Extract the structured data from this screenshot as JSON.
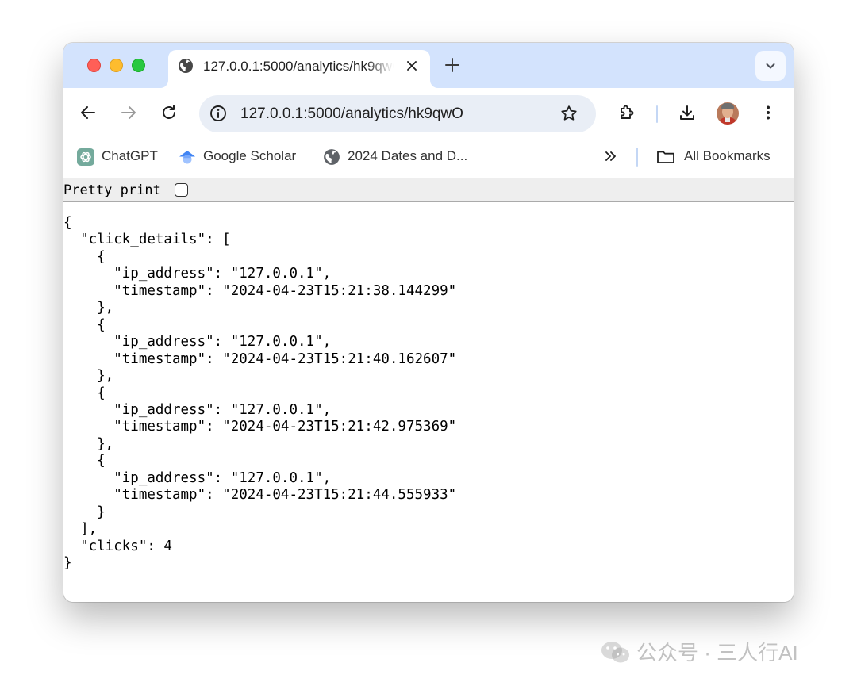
{
  "tab": {
    "title": "127.0.0.1:5000/analytics/hk9qwO",
    "icon": "globe-icon"
  },
  "toolbar": {
    "url": "127.0.0.1:5000/analytics/hk9qwO"
  },
  "bookmarks": {
    "items": [
      {
        "label": "ChatGPT",
        "icon": "chatgpt-icon"
      },
      {
        "label": "Google Scholar",
        "icon": "scholar-icon"
      },
      {
        "label": "2024 Dates and D...",
        "icon": "globe-icon"
      }
    ],
    "all_label": "All Bookmarks"
  },
  "pretty_print": {
    "label": "Pretty print",
    "checked": false
  },
  "json_text": "{\n  \"click_details\": [\n    {\n      \"ip_address\": \"127.0.0.1\",\n      \"timestamp\": \"2024-04-23T15:21:38.144299\"\n    },\n    {\n      \"ip_address\": \"127.0.0.1\",\n      \"timestamp\": \"2024-04-23T15:21:40.162607\"\n    },\n    {\n      \"ip_address\": \"127.0.0.1\",\n      \"timestamp\": \"2024-04-23T15:21:42.975369\"\n    },\n    {\n      \"ip_address\": \"127.0.0.1\",\n      \"timestamp\": \"2024-04-23T15:21:44.555933\"\n    }\n  ],\n  \"clicks\": 4\n}",
  "watermark": {
    "text": "公众号 · 三人行AI"
  },
  "colors": {
    "tabstrip": "#d3e3fd",
    "omnibox": "#e9eef6",
    "close_button": "#ff5f57",
    "minimize_button": "#febc2e",
    "zoom_button": "#28c840"
  }
}
